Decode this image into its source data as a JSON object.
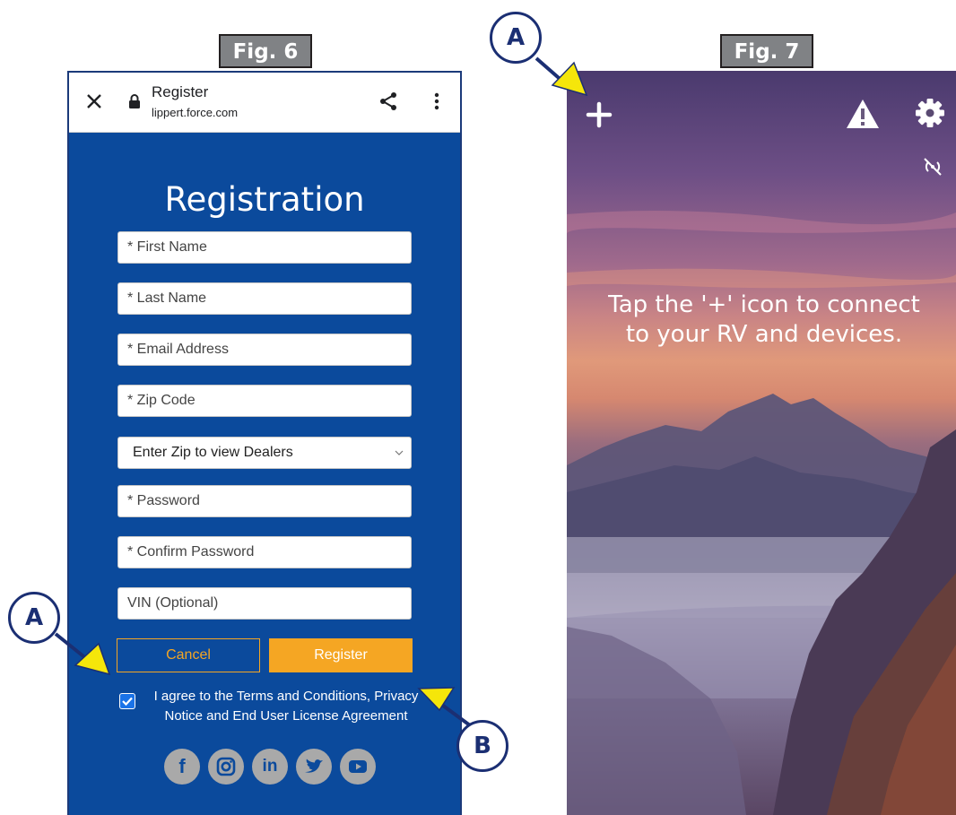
{
  "fig6": {
    "label": "Fig. 6",
    "browser": {
      "title": "Register",
      "url": "lippert.force.com"
    },
    "form": {
      "title": "Registration",
      "first_name": "* First Name",
      "last_name": "* Last Name",
      "email": "* Email Address",
      "zip": "* Zip Code",
      "dealer_select": "Enter Zip to view Dealers",
      "password": "* Password",
      "confirm_password": "* Confirm Password",
      "vin": "VIN (Optional)",
      "cancel": "Cancel",
      "register": "Register",
      "agree": "I agree to the Terms and Conditions, Privacy Notice and End User License Agreement",
      "agree_checked": true
    },
    "social": [
      "facebook-icon",
      "instagram-icon",
      "linkedin-icon",
      "twitter-icon",
      "youtube-icon"
    ],
    "colors": {
      "background": "#0b4a9c",
      "accent": "#f5a623"
    }
  },
  "fig7": {
    "label": "Fig. 7",
    "message": "Tap the '+' icon to connect to your RV and devices.",
    "icons": [
      "plus-icon",
      "warning-icon",
      "gear-icon",
      "no-signal-icon"
    ]
  },
  "callouts": {
    "fig6_a": "A",
    "fig6_b": "B",
    "fig7_a": "A"
  }
}
